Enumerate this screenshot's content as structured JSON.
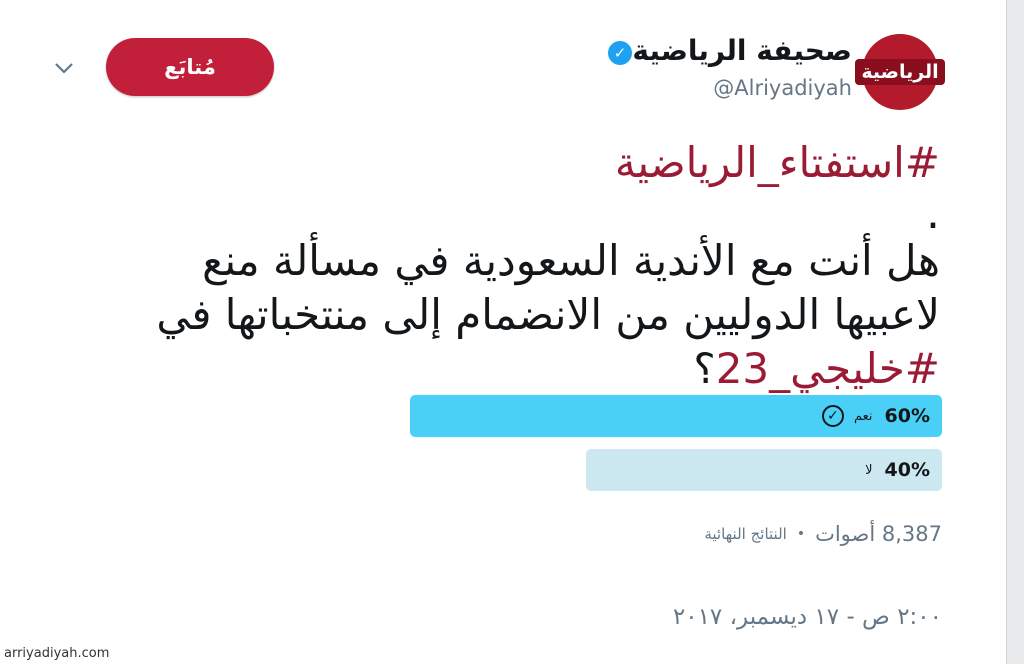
{
  "account": {
    "display_name": "صحيفة الرياضية",
    "handle": "@Alriyadiyah",
    "avatar_text": "الرياضية",
    "verified_symbol": "✓"
  },
  "follow_button": {
    "label": "مُتابَع"
  },
  "icons": {
    "chevron": "chevron-down-icon",
    "verified": "verified-badge-icon",
    "check": "checkmark-icon"
  },
  "tweet": {
    "hashtag_top": "#استفتاء_الرياضية",
    "dot": ".",
    "line1": "هل أنت مع الأندية السعودية في مسألة منع",
    "line2": "لاعبيها الدوليين من الانضمام إلى منتخباتها في",
    "hashtag_bottom": "#خليجي_23",
    "question_mark": "؟"
  },
  "poll": {
    "options": [
      {
        "percent": "60%",
        "label": "نعم",
        "fill": 0.6,
        "winner": true
      },
      {
        "percent": "40%",
        "label": "لا",
        "fill": 0.4,
        "winner": false
      }
    ],
    "votes": "8,387 أصوات",
    "separator": "•",
    "status": "النتائج النهائية"
  },
  "timestamp": "٢:٠٠ ص - ١٧ ديسمبر، ٢٠١٧",
  "watermark": "arriyadiyah.com",
  "colors": {
    "brand": "#c21f3a",
    "hashtag": "#9b1b34",
    "poll_winner": "#4ad0f7",
    "poll_other": "#cce9f2",
    "verified": "#1da1f2"
  }
}
